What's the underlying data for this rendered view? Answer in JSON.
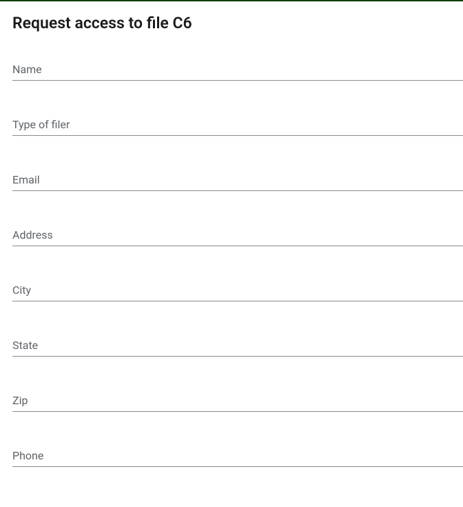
{
  "dialog": {
    "title": "Request access to file C6"
  },
  "fields": {
    "name": {
      "placeholder": "Name",
      "value": ""
    },
    "type_of_filer": {
      "placeholder": "Type of filer",
      "value": ""
    },
    "email": {
      "placeholder": "Email",
      "value": ""
    },
    "address": {
      "placeholder": "Address",
      "value": ""
    },
    "city": {
      "placeholder": "City",
      "value": ""
    },
    "state": {
      "placeholder": "State",
      "value": ""
    },
    "zip": {
      "placeholder": "Zip",
      "value": ""
    },
    "phone": {
      "placeholder": "Phone",
      "value": ""
    }
  }
}
